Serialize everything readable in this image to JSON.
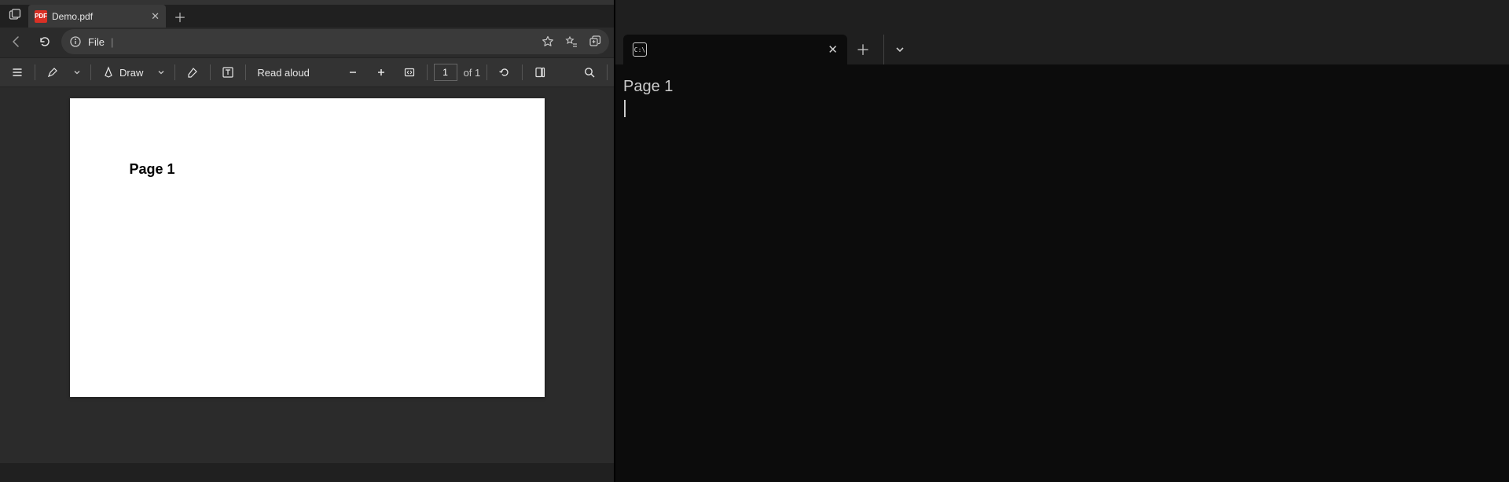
{
  "browser": {
    "tab": {
      "title": "Demo.pdf",
      "favicon_label": "PDF"
    },
    "address": {
      "scheme_label": "File",
      "divider": "|"
    },
    "pdf_toolbar": {
      "draw_label": "Draw",
      "read_aloud_label": "Read aloud",
      "page_current": "1",
      "page_total_label": "of 1"
    },
    "document": {
      "content": "Page 1"
    }
  },
  "terminal": {
    "tab": {
      "icon_text": "C:\\",
      "title": ""
    },
    "output": "Page 1"
  }
}
